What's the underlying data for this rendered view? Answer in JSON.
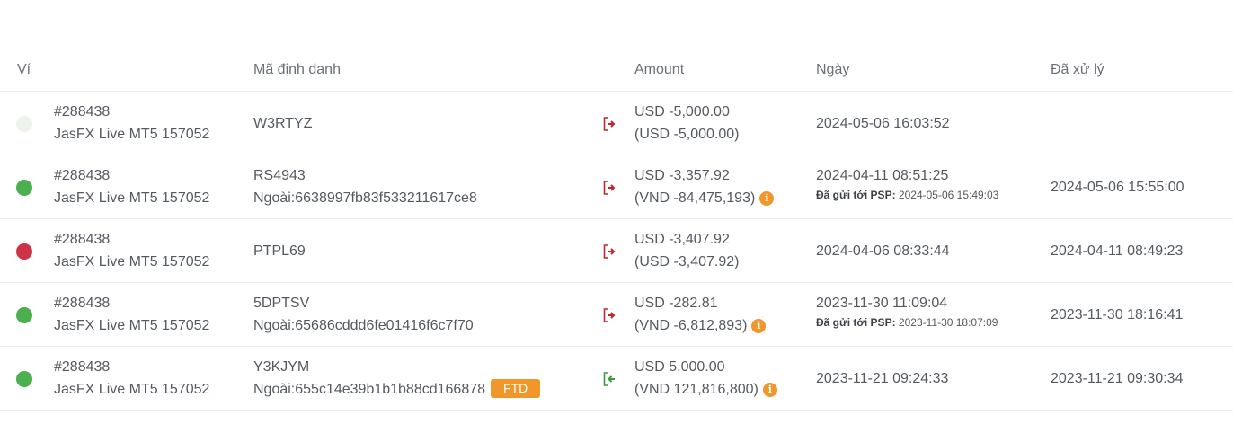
{
  "columns": {
    "wallet": "Ví",
    "identifier": "Mã định danh",
    "amount": "Amount",
    "date": "Ngày",
    "processed": "Đã xử lý"
  },
  "colors": {
    "pending": "#ebf3ea",
    "success": "#4caf50",
    "failed": "#cc3344",
    "withdraw_icon": "#c0262d",
    "deposit_icon": "#3c9b3c",
    "accent": "#f0962a"
  },
  "rows": [
    {
      "status": "pending",
      "wallet_id": "#288438",
      "wallet_name": "JasFX Live MT5 157052",
      "ident": "W3RTYZ",
      "external": "",
      "direction": "withdraw",
      "amount_usd": "USD -5,000.00",
      "amount_local": "(USD -5,000.00)",
      "date": "2024-05-06 16:03:52",
      "psp_label": "",
      "psp_date": "",
      "processed": ""
    },
    {
      "status": "success",
      "wallet_id": "#288438",
      "wallet_name": "JasFX Live MT5 157052",
      "ident": "RS4943",
      "external": "Ngoài:6638997fb83f533211617ce8",
      "direction": "withdraw",
      "amount_usd": "USD -3,357.92",
      "amount_local": "(VND -84,475,193)",
      "date": "2024-04-11 08:51:25",
      "psp_label": "Đã gửi tới PSP:",
      "psp_date": "2024-05-06 15:49:03",
      "processed": "2024-05-06 15:55:00"
    },
    {
      "status": "failed",
      "wallet_id": "#288438",
      "wallet_name": "JasFX Live MT5 157052",
      "ident": "PTPL69",
      "external": "",
      "direction": "withdraw",
      "amount_usd": "USD -3,407.92",
      "amount_local": "(USD -3,407.92)",
      "date": "2024-04-06 08:33:44",
      "psp_label": "",
      "psp_date": "",
      "processed": "2024-04-11 08:49:23"
    },
    {
      "status": "success",
      "wallet_id": "#288438",
      "wallet_name": "JasFX Live MT5 157052",
      "ident": "5DPTSV",
      "external": "Ngoài:65686cddd6fe01416f6c7f70",
      "direction": "withdraw",
      "amount_usd": "USD -282.81",
      "amount_local": "(VND -6,812,893)",
      "date": "2023-11-30 11:09:04",
      "psp_label": "Đã gửi tới PSP:",
      "psp_date": "2023-11-30 18:07:09",
      "processed": "2023-11-30 18:16:41"
    },
    {
      "status": "success",
      "wallet_id": "#288438",
      "wallet_name": "JasFX Live MT5 157052",
      "ident": "Y3KJYM",
      "external": "Ngoài:655c14e39b1b1b88cd166878",
      "badge": "FTD",
      "direction": "deposit",
      "amount_usd": "USD 5,000.00",
      "amount_local": "(VND 121,816,800)",
      "date": "2023-11-21 09:24:33",
      "psp_label": "",
      "psp_date": "",
      "processed": "2023-11-21 09:30:34"
    }
  ]
}
